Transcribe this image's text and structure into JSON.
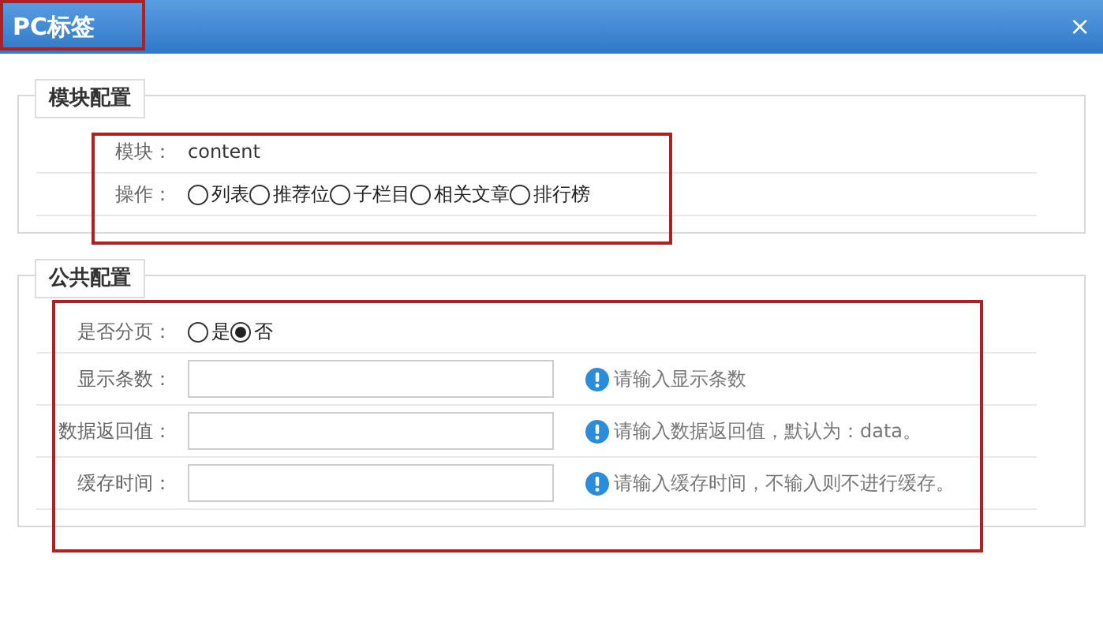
{
  "window": {
    "title": "PC标签",
    "close": "×",
    "highlighted": true
  },
  "sections": [
    {
      "legend": "模块配置",
      "highlighted": true,
      "rows": [
        {
          "kind": "text",
          "label": "模块：",
          "value": "content"
        },
        {
          "kind": "radio",
          "label": "操作：",
          "options": [
            {
              "label": "列表",
              "selected": false
            },
            {
              "label": "推荐位",
              "selected": false
            },
            {
              "label": "子栏目",
              "selected": false
            },
            {
              "label": "相关文章",
              "selected": false
            },
            {
              "label": "排行榜",
              "selected": false
            }
          ]
        }
      ]
    },
    {
      "legend": "公共配置",
      "highlighted": true,
      "rows": [
        {
          "kind": "radio",
          "label": "是否分页：",
          "options": [
            {
              "label": "是",
              "selected": false
            },
            {
              "label": "否",
              "selected": true
            }
          ]
        },
        {
          "kind": "input",
          "label": "显示条数：",
          "hint": "请输入显示条数"
        },
        {
          "kind": "input",
          "label": "数据返回值：",
          "hint": "请输入数据返回值，默认为：data。"
        },
        {
          "kind": "input",
          "label": "缓存时间：",
          "hint": "请输入缓存时间，不输入则不进行缓存。"
        }
      ]
    }
  ]
}
